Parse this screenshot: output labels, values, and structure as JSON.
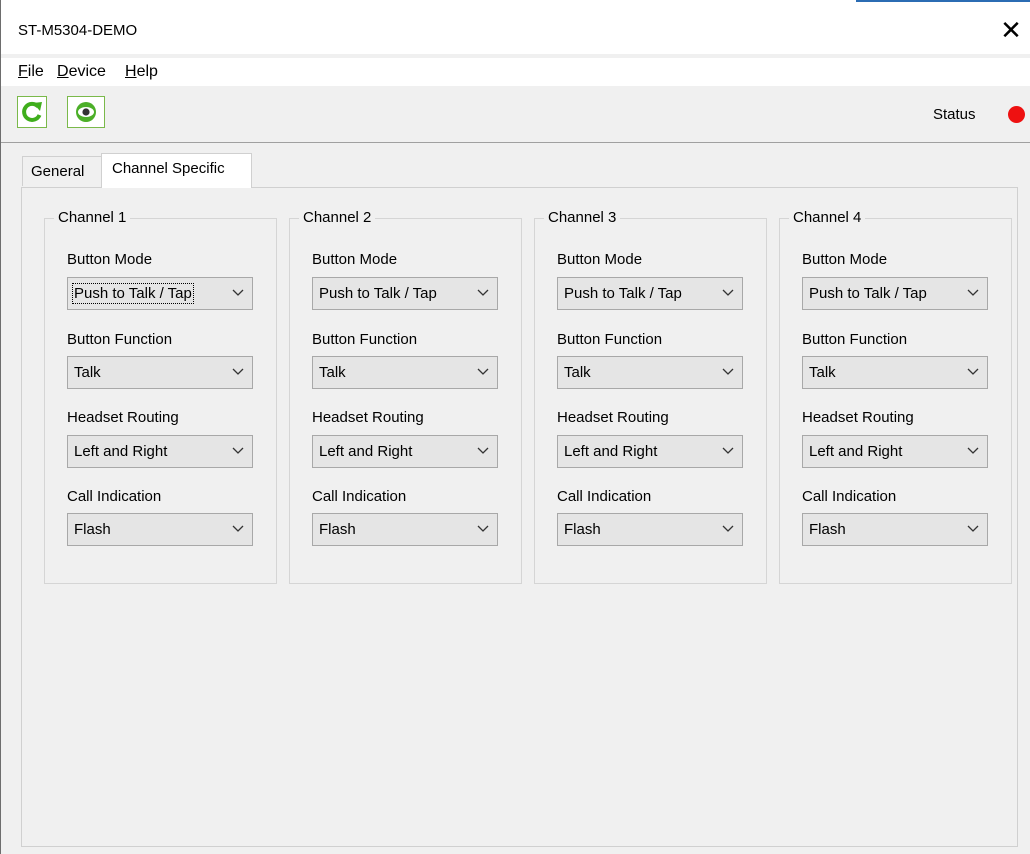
{
  "window": {
    "title": "ST-M5304-DEMO",
    "close_glyph": "✕"
  },
  "menu": {
    "items": [
      {
        "first": "F",
        "rest": "ile"
      },
      {
        "first": "D",
        "rest": "evice"
      },
      {
        "first": "H",
        "rest": "elp"
      }
    ]
  },
  "toolbar": {
    "buttons": [
      {
        "icon": "refresh-icon"
      },
      {
        "icon": "eye-icon"
      }
    ],
    "status_label": "Status",
    "status_color": "#ee1111"
  },
  "tabs": [
    {
      "label": "General",
      "active": false
    },
    {
      "label": "Channel Specific",
      "active": true
    }
  ],
  "channels": [
    {
      "title": "Channel 1",
      "fields": [
        {
          "label": "Button Mode",
          "value": "Push to Talk / Tap"
        },
        {
          "label": "Button Function",
          "value": "Talk"
        },
        {
          "label": "Headset Routing",
          "value": "Left and Right"
        },
        {
          "label": "Call Indication",
          "value": "Flash"
        }
      ]
    },
    {
      "title": "Channel 2",
      "fields": [
        {
          "label": "Button Mode",
          "value": "Push to Talk / Tap"
        },
        {
          "label": "Button Function",
          "value": "Talk"
        },
        {
          "label": "Headset Routing",
          "value": "Left and Right"
        },
        {
          "label": "Call Indication",
          "value": "Flash"
        }
      ]
    },
    {
      "title": "Channel 3",
      "fields": [
        {
          "label": "Button Mode",
          "value": "Push to Talk / Tap"
        },
        {
          "label": "Button Function",
          "value": "Talk"
        },
        {
          "label": "Headset Routing",
          "value": "Left and Right"
        },
        {
          "label": "Call Indication",
          "value": "Flash"
        }
      ]
    },
    {
      "title": "Channel 4",
      "fields": [
        {
          "label": "Button Mode",
          "value": "Push to Talk / Tap"
        },
        {
          "label": "Button Function",
          "value": "Talk"
        },
        {
          "label": "Headset Routing",
          "value": "Left and Right"
        },
        {
          "label": "Call Indication",
          "value": "Flash"
        }
      ]
    }
  ]
}
